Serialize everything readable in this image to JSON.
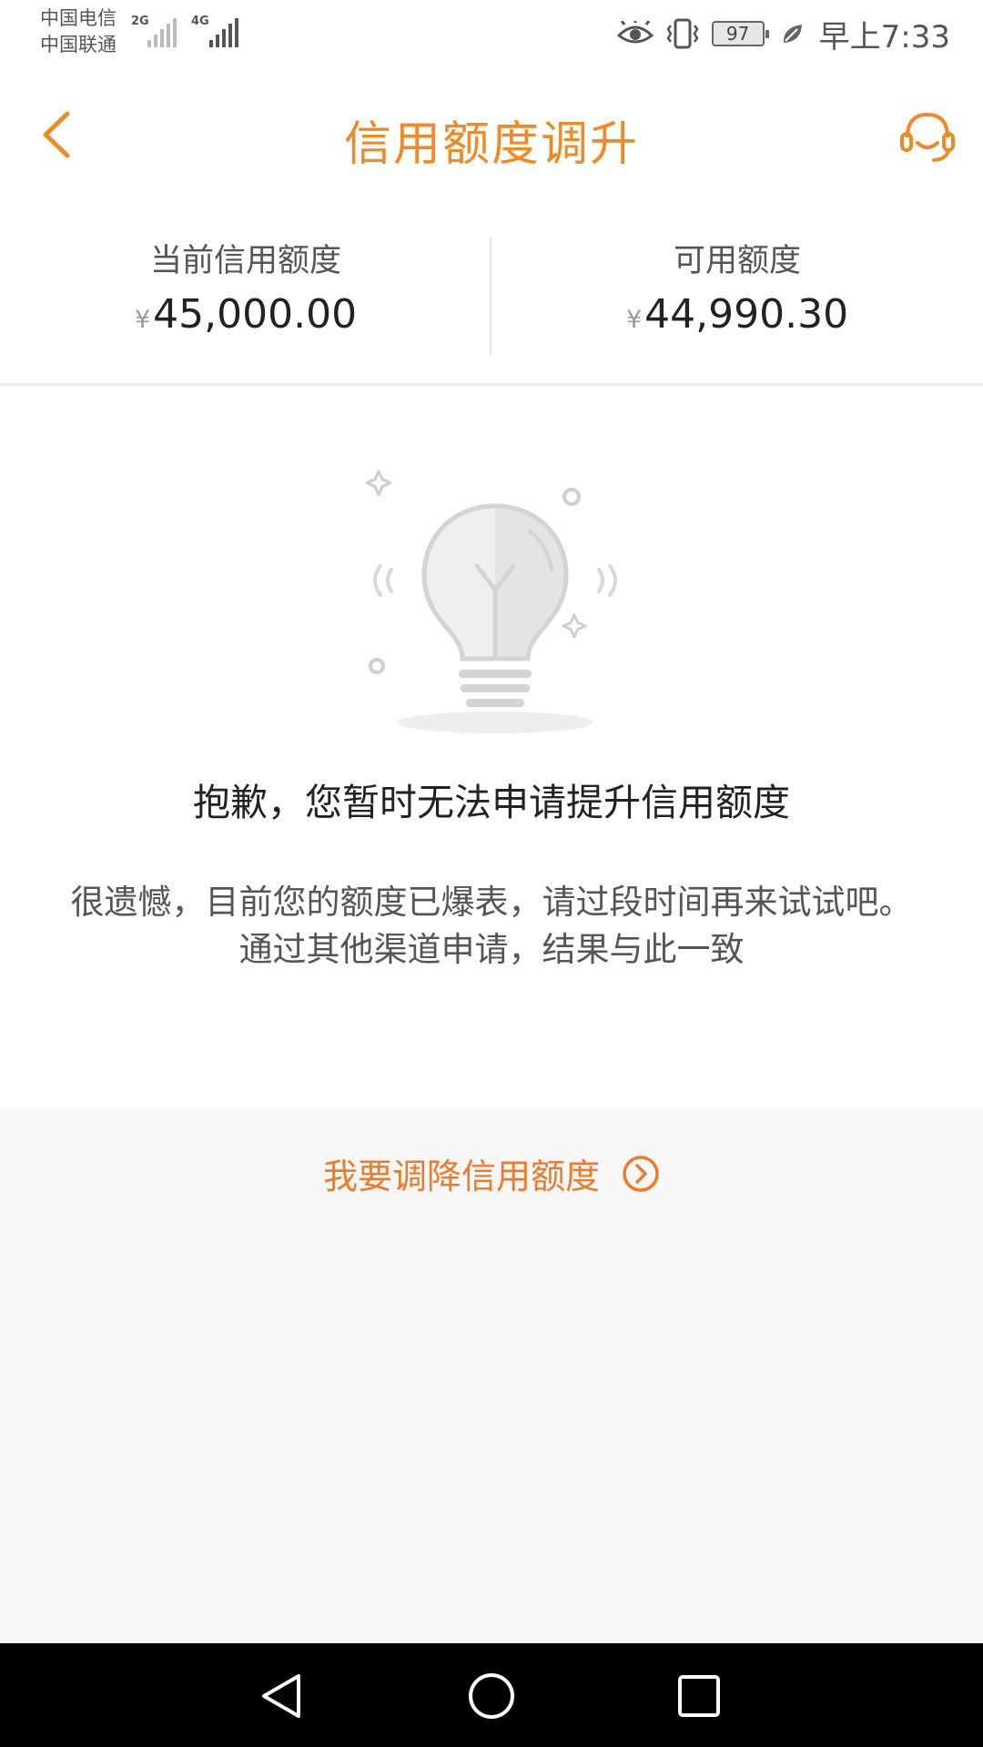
{
  "status_bar": {
    "carrier_1": "中国电信",
    "carrier_2": "中国联通",
    "network_1": "2G",
    "network_2": "4G",
    "battery": "97",
    "time": "早上7:33"
  },
  "header": {
    "title": "信用额度调升",
    "back_icon": "chevron-left-icon",
    "support_icon": "headset-icon"
  },
  "summary": {
    "credit_limit_label": "当前信用额度",
    "credit_limit_currency": "¥",
    "credit_limit_value": "45,000.00",
    "available_label": "可用额度",
    "available_currency": "¥",
    "available_value": "44,990.30"
  },
  "result": {
    "illustration_icon": "lightbulb-icon",
    "headline": "抱歉，您暂时无法申请提升信用额度",
    "message_line_1": "很遗憾，目前您的额度已爆表，请过段时间再来试试吧。",
    "message_line_2": "通过其他渠道申请，结果与此一致"
  },
  "actions": {
    "reduce_label": "我要调降信用额度",
    "reduce_icon": "circle-chevron-right-icon"
  },
  "colors": {
    "accent": "#f08a24",
    "link": "#f07a2a",
    "text_dark": "#222222",
    "text_muted": "#555555"
  }
}
